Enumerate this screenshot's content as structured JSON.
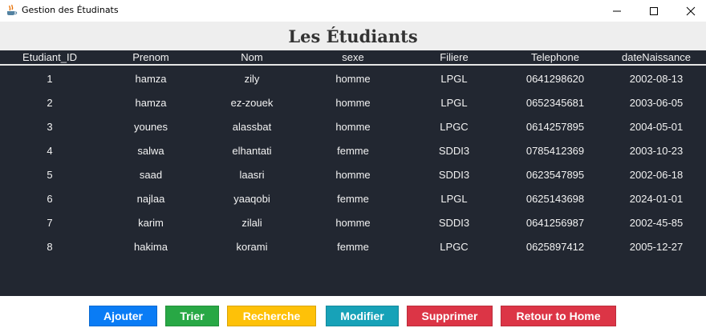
{
  "window": {
    "title": "Gestion des Étudinats",
    "icon": "java-cup-icon",
    "controls": [
      "minimize-icon",
      "maximize-icon",
      "close-icon"
    ]
  },
  "page": {
    "title": "Les Étudiants"
  },
  "table": {
    "columns": [
      "Etudiant_ID",
      "Prenom",
      "Nom",
      "sexe",
      "Filiere",
      "Telephone",
      "dateNaissance"
    ],
    "rows": [
      [
        "1",
        "hamza",
        "zily",
        "homme",
        "LPGL",
        "0641298620",
        "2002-08-13"
      ],
      [
        "2",
        "hamza",
        "ez-zouek",
        "homme",
        "LPGL",
        "0652345681",
        "2003-06-05"
      ],
      [
        "3",
        "younes",
        "alassbat",
        "homme",
        "LPGC",
        "0614257895",
        "2004-05-01"
      ],
      [
        "4",
        "salwa",
        "elhantati",
        "femme",
        "SDDI3",
        "0785412369",
        "2003-10-23"
      ],
      [
        "5",
        "saad",
        "laasri",
        "homme",
        "SDDI3",
        "0623547895",
        "2002-06-18"
      ],
      [
        "6",
        "najlaa",
        "yaaqobi",
        "femme",
        "LPGL",
        "0625143698",
        "2024-01-01"
      ],
      [
        "7",
        "karim",
        "zilali",
        "homme",
        "SDDI3",
        "0641256987",
        "2002-45-85"
      ],
      [
        "8",
        "hakima",
        "korami",
        "femme",
        "LPGC",
        "0625897412",
        "2005-12-27"
      ]
    ]
  },
  "buttons": {
    "add": "Ajouter",
    "sort": "Trier",
    "search": "Recherche",
    "edit": "Modifier",
    "delete": "Supprimer",
    "home": "Retour to Home"
  },
  "colors": {
    "table_bg": "#222731",
    "add": "#0a7cf5",
    "sort": "#28a845",
    "search": "#fec108",
    "edit": "#17a2b8",
    "delete": "#dc3546",
    "home": "#dc3546"
  }
}
